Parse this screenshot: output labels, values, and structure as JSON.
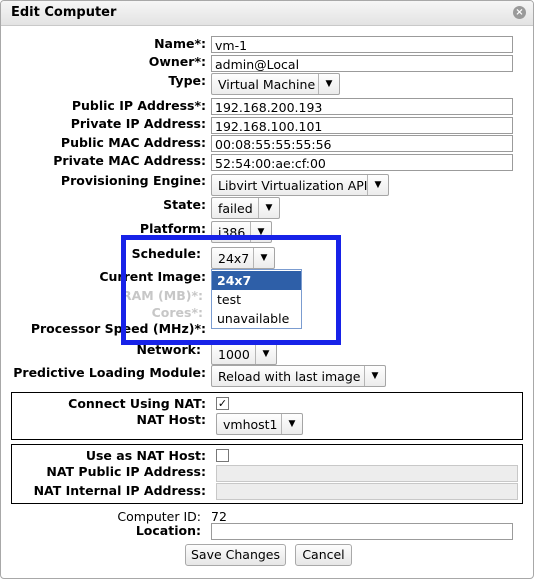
{
  "dialog": {
    "title": "Edit Computer"
  },
  "fields": {
    "name": {
      "label": "Name*:",
      "value": "vm-1"
    },
    "owner": {
      "label": "Owner*:",
      "value": "admin@Local"
    },
    "type": {
      "label": "Type:",
      "value": "Virtual Machine"
    },
    "public_ip": {
      "label": "Public IP Address*:",
      "value": "192.168.200.193"
    },
    "private_ip": {
      "label": "Private IP Address:",
      "value": "192.168.100.101"
    },
    "public_mac": {
      "label": "Public MAC Address:",
      "value": "00:08:55:55:55:56"
    },
    "private_mac": {
      "label": "Private MAC Address:",
      "value": "52:54:00:ae:cf:00"
    },
    "provisioning": {
      "label": "Provisioning Engine:",
      "value": "Libvirt Virtualization API"
    },
    "state": {
      "label": "State:",
      "value": "failed"
    },
    "platform": {
      "label": "Platform:",
      "value": "i386"
    },
    "schedule": {
      "label": "Schedule:",
      "value": "24x7",
      "options": [
        "24x7",
        "test",
        "unavailable"
      ]
    },
    "current_image": {
      "label": "Current Image:"
    },
    "ram": {
      "label": "RAM (MB)*:"
    },
    "cores": {
      "label": "Cores*:"
    },
    "processor_speed": {
      "label": "Processor Speed (MHz)*:"
    },
    "network": {
      "label": "Network:",
      "value": "1000"
    },
    "predictive": {
      "label": "Predictive Loading Module:",
      "value": "Reload with last image"
    },
    "connect_nat": {
      "label": "Connect Using NAT:",
      "checked": "✓"
    },
    "nat_host": {
      "label": "NAT Host:",
      "value": "vmhost1"
    },
    "use_nat_host": {
      "label": "Use as NAT Host:"
    },
    "nat_public_ip": {
      "label": "NAT Public IP Address:"
    },
    "nat_internal_ip": {
      "label": "NAT Internal IP Address:"
    },
    "computer_id": {
      "label": "Computer ID:",
      "value": "72"
    },
    "location": {
      "label": "Location:",
      "value": ""
    }
  },
  "buttons": {
    "save": "Save Changes",
    "cancel": "Cancel"
  },
  "icons": {
    "close": "close-icon",
    "dropdown_arrow": "chevron-down-icon",
    "check": "checkmark-icon"
  },
  "colors": {
    "highlight": "#1722e8",
    "selected_option": "#2e5fa8"
  }
}
